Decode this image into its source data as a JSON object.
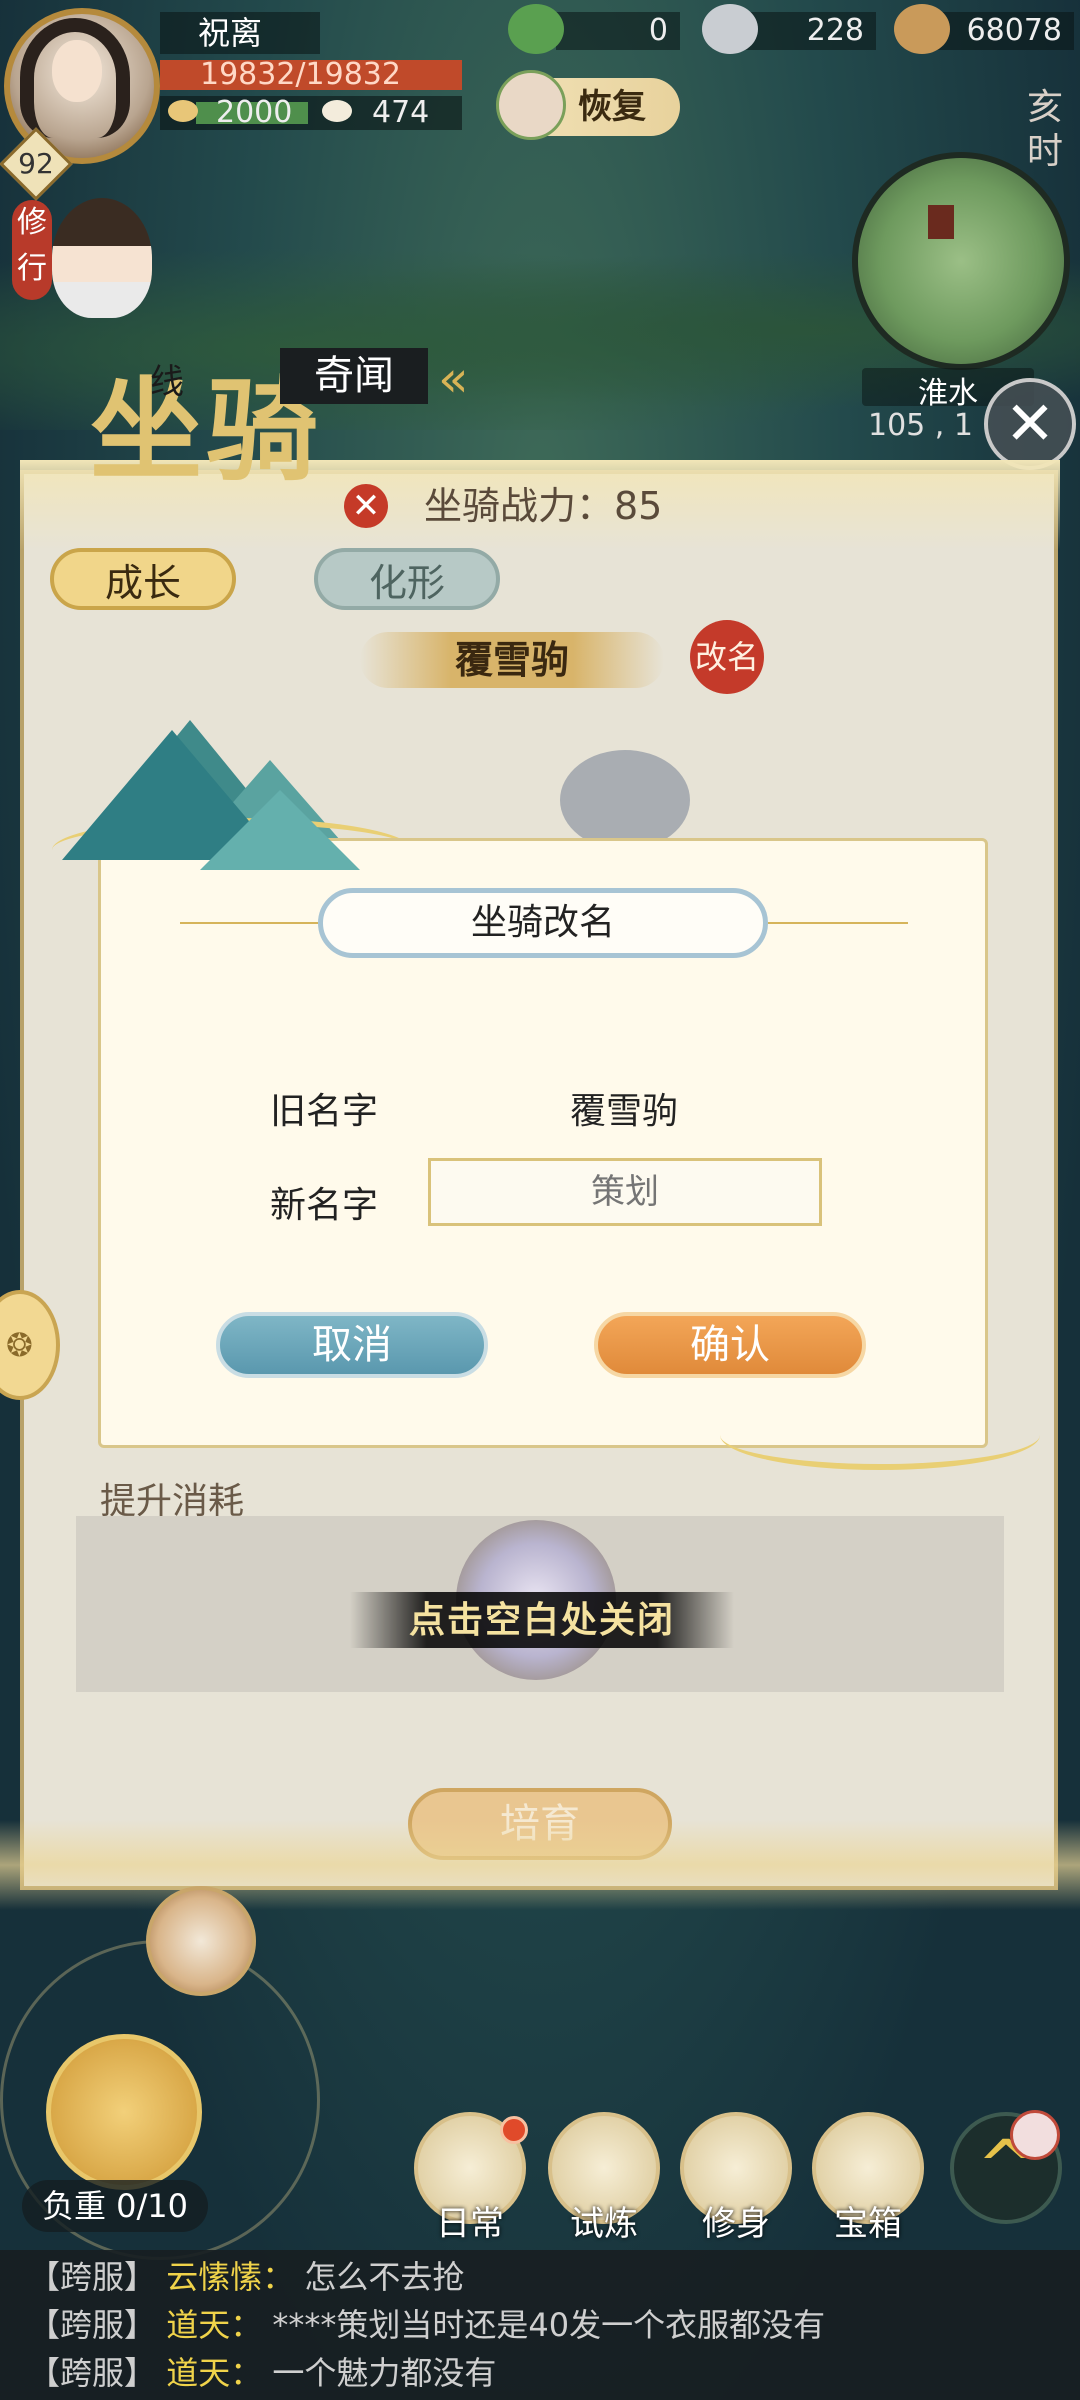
{
  "player": {
    "name": "祝离",
    "level": "92",
    "hp": "19832/19832",
    "stat1": "2000",
    "stat2": "474"
  },
  "currencies": [
    {
      "icon": "jade-leaf-icon",
      "value": "0"
    },
    {
      "icon": "silver-ingot-icon",
      "value": "228"
    },
    {
      "icon": "copper-coin-icon",
      "value": "68078"
    }
  ],
  "restore_label": "恢复",
  "time_label": "亥时",
  "map": {
    "location": "淮水",
    "coords": "105 , 1"
  },
  "side_tag": "修行",
  "header": {
    "title": "坐骑",
    "route_text": "线",
    "wonder_tab": "奇闻"
  },
  "mount": {
    "power_label": "坐骑战力：85",
    "tabs": [
      "成长",
      "化形"
    ],
    "name": "覆雪驹",
    "rename_seal": "改名",
    "cost_label": "提升消耗",
    "foster_button": "培育"
  },
  "dialog": {
    "title": "坐骑改名",
    "old_name_label": "旧名字",
    "old_name_value": "覆雪驹",
    "new_name_label": "新名字",
    "new_name_placeholder": "策划",
    "cancel": "取消",
    "confirm": "确认"
  },
  "close_tip": "点击空白处关闭",
  "bottom_nav": {
    "load": "负重 0/10",
    "items": [
      "日常",
      "试炼",
      "修身",
      "宝箱"
    ]
  },
  "chat": [
    {
      "channel": "【跨服】",
      "name": "云愫愫：",
      "message": "怎么不去抢"
    },
    {
      "channel": "【跨服】",
      "name": "道天：",
      "message": "****策划当时还是40发一个衣服都没有"
    },
    {
      "channel": "【跨服】",
      "name": "道天：",
      "message": "一个魅力都没有"
    }
  ],
  "colors": {
    "accent_gold": "#d9b456",
    "cancel_blue": "#5a98ae",
    "confirm_orange": "#e08a3a",
    "seal_red": "#c43a2a"
  }
}
